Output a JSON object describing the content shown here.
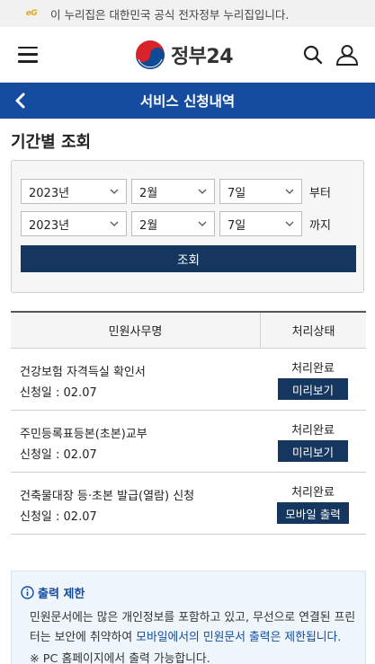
{
  "gov_banner": {
    "flag_text": "eG",
    "text": "이 누리집은 대한민국 공식 전자정부 누리집입니다."
  },
  "header": {
    "logo_text": "정부24"
  },
  "title_bar": {
    "title": "서비스 신청내역"
  },
  "page": {
    "section_title": "기간별 조회"
  },
  "search": {
    "from": {
      "year": "2023년",
      "month": "2월",
      "day": "7일",
      "suffix": "부터"
    },
    "to": {
      "year": "2023년",
      "month": "2월",
      "day": "7일",
      "suffix": "까지"
    },
    "button_label": "조회"
  },
  "table": {
    "headers": [
      "민원사무명",
      "처리상태"
    ],
    "rows": [
      {
        "name": "건강보험 자격득실 확인서",
        "date": "신청일 : 02.07",
        "status": "처리완료",
        "action": "미리보기"
      },
      {
        "name": "주민등록표등본(초본)교부",
        "date": "신청일 : 02.07",
        "status": "처리완료",
        "action": "미리보기"
      },
      {
        "name": "건축물대장 등·초본 발급(열람) 신청",
        "date": "신청일 : 02.07",
        "status": "처리완료",
        "action": "모바일 출력"
      }
    ]
  },
  "notice": {
    "title": "출력 제한",
    "text_1": "민원문서에는 많은 개인정보를 포함하고 있고, 무선으로 연결된 프린터는 보안에 취약하여 ",
    "text_highlight": "모바일에서의 민원문서 출력은 제한됩니다.",
    "text_2": "※ PC 홈페이지에서 출력 가능합니다."
  },
  "colors": {
    "primary_blue": "#154ca0",
    "navy_button": "#15365f",
    "banner_bg": "#f1f1f1",
    "notice_bg": "#eef5fb"
  },
  "icons": {
    "menu": "hamburger-icon",
    "search": "search-icon",
    "user": "user-icon",
    "back": "chevron-left-icon",
    "info": "info-circle-icon",
    "logo": "taegeuk-logo-icon"
  }
}
